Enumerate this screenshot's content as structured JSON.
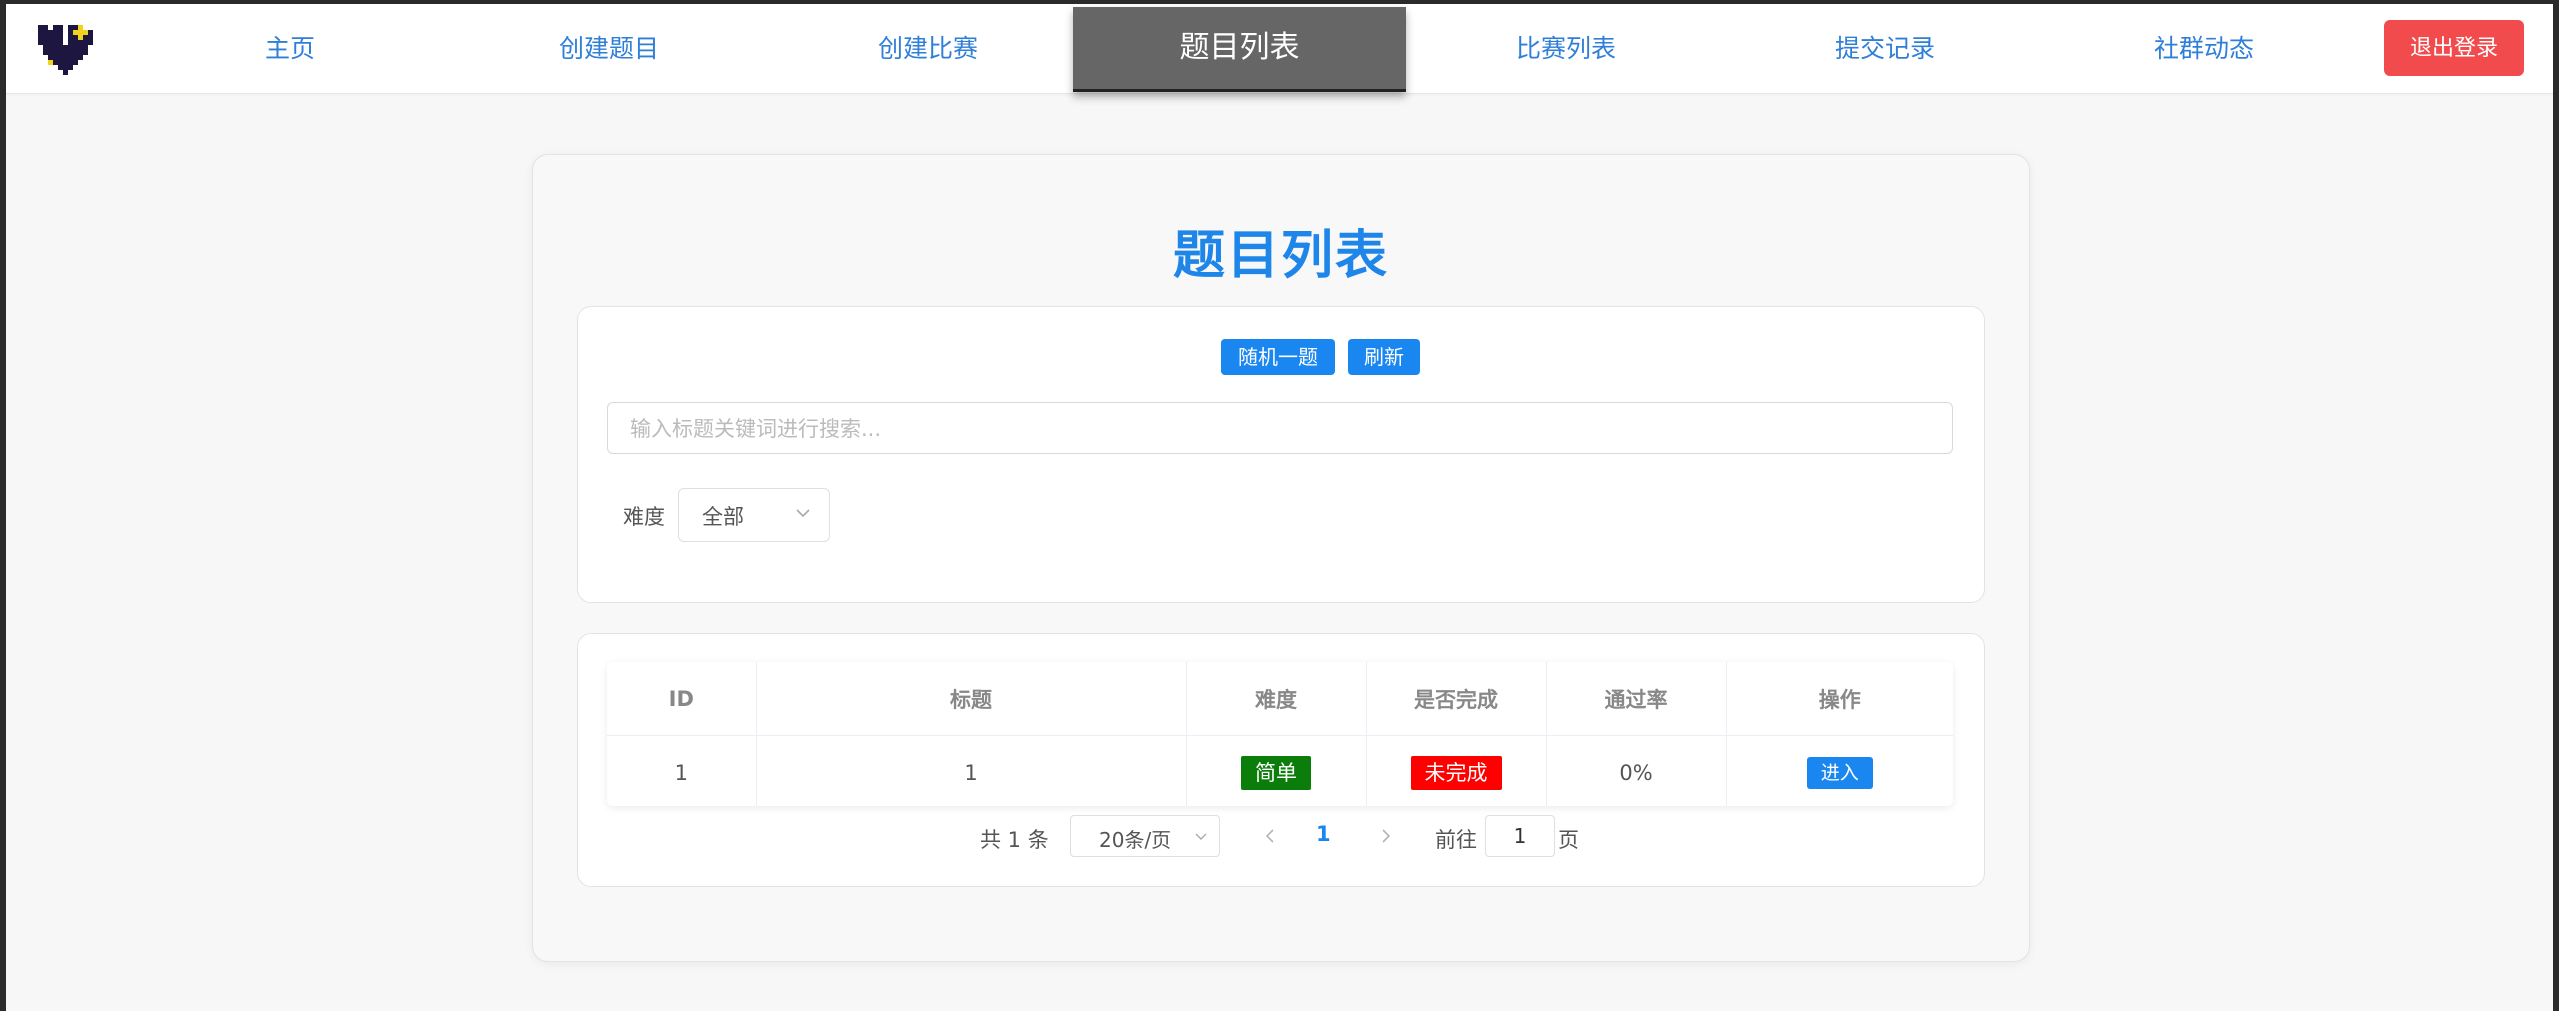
{
  "nav": {
    "links": [
      {
        "label": "主页"
      },
      {
        "label": "创建题目"
      },
      {
        "label": "创建比赛"
      },
      {
        "label": "题目列表"
      },
      {
        "label": "比赛列表"
      },
      {
        "label": "提交记录"
      },
      {
        "label": "社群动态"
      }
    ],
    "active_index": 3,
    "logout_label": "退出登录"
  },
  "main": {
    "title": "题目列表",
    "buttons": {
      "random": "随机一题",
      "refresh": "刷新"
    },
    "search": {
      "placeholder": "输入标题关键词进行搜索...",
      "value": ""
    },
    "difficulty": {
      "label": "难度",
      "selected": "全部"
    },
    "table": {
      "headers": [
        "ID",
        "标题",
        "难度",
        "是否完成",
        "通过率",
        "操作"
      ],
      "rows": [
        {
          "id": "1",
          "title": "1",
          "difficulty": "简单",
          "completed": "未完成",
          "pass_rate": "0%",
          "action": "进入"
        }
      ]
    },
    "pagination": {
      "total_text": "共 1 条",
      "page_size": "20条/页",
      "current_page": "1",
      "goto_prefix": "前往",
      "goto_value": "1",
      "goto_suffix": "页"
    }
  },
  "colors": {
    "accent": "#1a86f0",
    "title": "#1e86e8",
    "logout": "#f14b4e",
    "active_tab": "#666666",
    "easy": "#0b7d0b",
    "incomplete": "#ff0000"
  }
}
